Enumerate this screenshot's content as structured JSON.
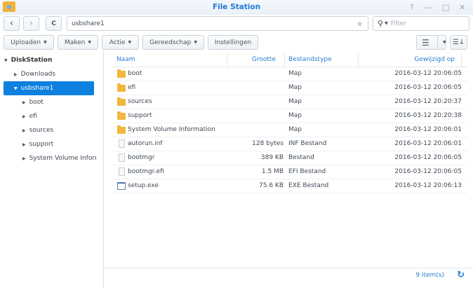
{
  "window": {
    "title": "File Station",
    "help": "?",
    "minimize": "—",
    "maximize": "□",
    "close": "✕"
  },
  "nav": {
    "back": "‹",
    "forward": "›",
    "refresh": "C",
    "path": "usbshare1",
    "star": "★",
    "filter_placeholder": "Filter"
  },
  "toolbar": {
    "upload": "Uploaden",
    "create": "Maken",
    "action": "Actie",
    "tools": "Gereedschap",
    "settings": "Instellingen"
  },
  "sidebar": {
    "root": "DiskStation",
    "items": [
      {
        "label": "Downloads",
        "level": 1
      },
      {
        "label": "usbshare1",
        "level": 1,
        "selected": true,
        "expanded": true
      },
      {
        "label": "boot",
        "level": 2
      },
      {
        "label": "efi",
        "level": 2
      },
      {
        "label": "sources",
        "level": 2
      },
      {
        "label": "support",
        "level": 2
      },
      {
        "label": "System Volume Information",
        "level": 2
      }
    ]
  },
  "table": {
    "headers": {
      "name": "Naam",
      "size": "Grootte",
      "type": "Bestandstype",
      "modified": "Gewijzigd op"
    },
    "rows": [
      {
        "icon": "folder",
        "name": "boot",
        "size": "",
        "type": "Map",
        "modified": "2016-03-12 20:06:05"
      },
      {
        "icon": "folder",
        "name": "efi",
        "size": "",
        "type": "Map",
        "modified": "2016-03-12 20:06:05"
      },
      {
        "icon": "folder",
        "name": "sources",
        "size": "",
        "type": "Map",
        "modified": "2016-03-12 20:20:37"
      },
      {
        "icon": "folder",
        "name": "support",
        "size": "",
        "type": "Map",
        "modified": "2016-03-12 20:20:38"
      },
      {
        "icon": "folder",
        "name": "System Volume Information",
        "size": "",
        "type": "Map",
        "modified": "2016-03-12 20:06:01"
      },
      {
        "icon": "file",
        "name": "autorun.inf",
        "size": "128 bytes",
        "type": "INF Bestand",
        "modified": "2016-03-12 20:06:01"
      },
      {
        "icon": "file",
        "name": "bootmgr",
        "size": "389 KB",
        "type": "Bestand",
        "modified": "2016-03-12 20:06:05"
      },
      {
        "icon": "file",
        "name": "bootmgr.efi",
        "size": "1.5 MB",
        "type": "EFI Bestand",
        "modified": "2016-03-12 20:06:05"
      },
      {
        "icon": "exe",
        "name": "setup.exe",
        "size": "75.6 KB",
        "type": "EXE Bestand",
        "modified": "2016-03-12 20:06:13"
      }
    ]
  },
  "footer": {
    "count": "9 item(s)",
    "refresh": "↻"
  }
}
